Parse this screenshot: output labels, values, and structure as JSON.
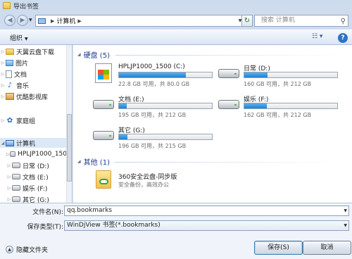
{
  "window": {
    "title": "导出书签"
  },
  "address": {
    "crumb": "计算机",
    "refresh": "↻"
  },
  "search": {
    "placeholder": "搜索 计算机",
    "icon": "search-icon"
  },
  "toolbar": {
    "organize": "组织",
    "view_icon": "view-options-icon",
    "help": "?"
  },
  "nav_tree": [
    {
      "label": "天翼云盘下载",
      "icon": "folder"
    },
    {
      "label": "图片",
      "icon": "pictures"
    },
    {
      "label": "文档",
      "icon": "documents"
    },
    {
      "label": "音乐",
      "icon": "music"
    },
    {
      "label": "优酷影视库",
      "icon": "library"
    },
    {
      "label": "家庭组",
      "icon": "homegroup"
    },
    {
      "label": "计算机",
      "icon": "computer"
    },
    {
      "label": "HPLJP1000_150",
      "icon": "drive"
    },
    {
      "label": "日常 (D:)",
      "icon": "drive"
    },
    {
      "label": "文档 (E:)",
      "icon": "drive"
    },
    {
      "label": "娱乐 (F:)",
      "icon": "drive"
    },
    {
      "label": "其它 (G:)",
      "icon": "drive"
    }
  ],
  "content": {
    "drives_header": "硬盘 (5)",
    "drives": [
      {
        "name": "HPLJP1000_1500 (C:)",
        "size": "22.8 GB 可用，共 80.0 GB",
        "used_fraction": 0.72,
        "icon": "windows-drive"
      },
      {
        "name": "日常 (D:)",
        "size": "160 GB 可用，共 212 GB",
        "used_fraction": 0.25,
        "icon": "disk"
      },
      {
        "name": "文档 (E:)",
        "size": "195 GB 可用，共 212 GB",
        "used_fraction": 0.08,
        "icon": "disk"
      },
      {
        "name": "娱乐 (F:)",
        "size": "162 GB 可用，共 212 GB",
        "used_fraction": 0.24,
        "icon": "disk"
      },
      {
        "name": "其它 (G:)",
        "size": "196 GB 可用，共 215 GB",
        "used_fraction": 0.09,
        "icon": "disk"
      }
    ],
    "other_header": "其他 (1)",
    "other": {
      "name": "360安全云盘-同步版",
      "desc": "安全备份，高效办公"
    }
  },
  "fields": {
    "filename_label": "文件名(N):",
    "filename_value": "qq.bookmarks",
    "filetype_label": "保存类型(T):",
    "filetype_value": "WinDjView 书签(*.bookmarks)"
  },
  "footer": {
    "hide_folders": "隐藏文件夹",
    "save": "保存(S)",
    "cancel": "取消"
  },
  "colors": {
    "usage_bar": "#1f7fd0",
    "group_header": "#1e3d8f"
  }
}
